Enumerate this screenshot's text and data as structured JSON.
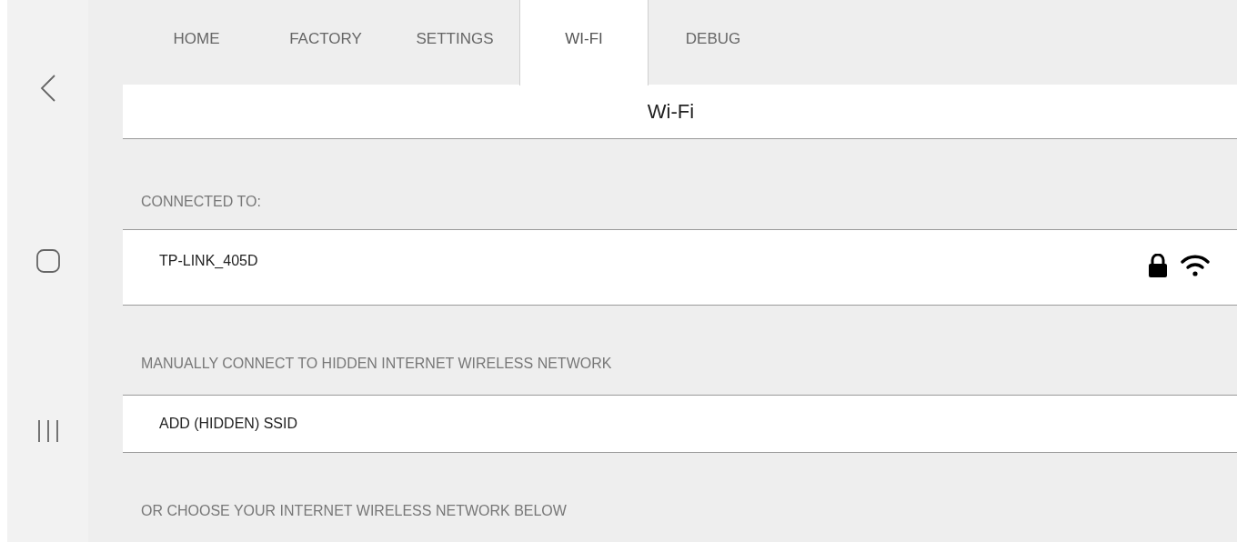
{
  "tabs": [
    {
      "label": "HOME",
      "selected": false
    },
    {
      "label": "FACTORY",
      "selected": false
    },
    {
      "label": "SETTINGS",
      "selected": false
    },
    {
      "label": "WI-FI",
      "selected": true
    },
    {
      "label": "DEBUG",
      "selected": false
    }
  ],
  "page_title": "Wi-Fi",
  "sections": [
    {
      "heading": "CONNECTED TO:",
      "rows": [
        {
          "label": "TP-LINK_405D",
          "locked": true
        }
      ]
    },
    {
      "heading": "MANUALLY CONNECT TO HIDDEN INTERNET WIRELESS NETWORK",
      "rows": [
        {
          "label": "ADD (HIDDEN) SSID",
          "locked": false
        }
      ]
    },
    {
      "heading": "OR CHOOSE YOUR INTERNET WIRELESS NETWORK BELOW"
    }
  ]
}
